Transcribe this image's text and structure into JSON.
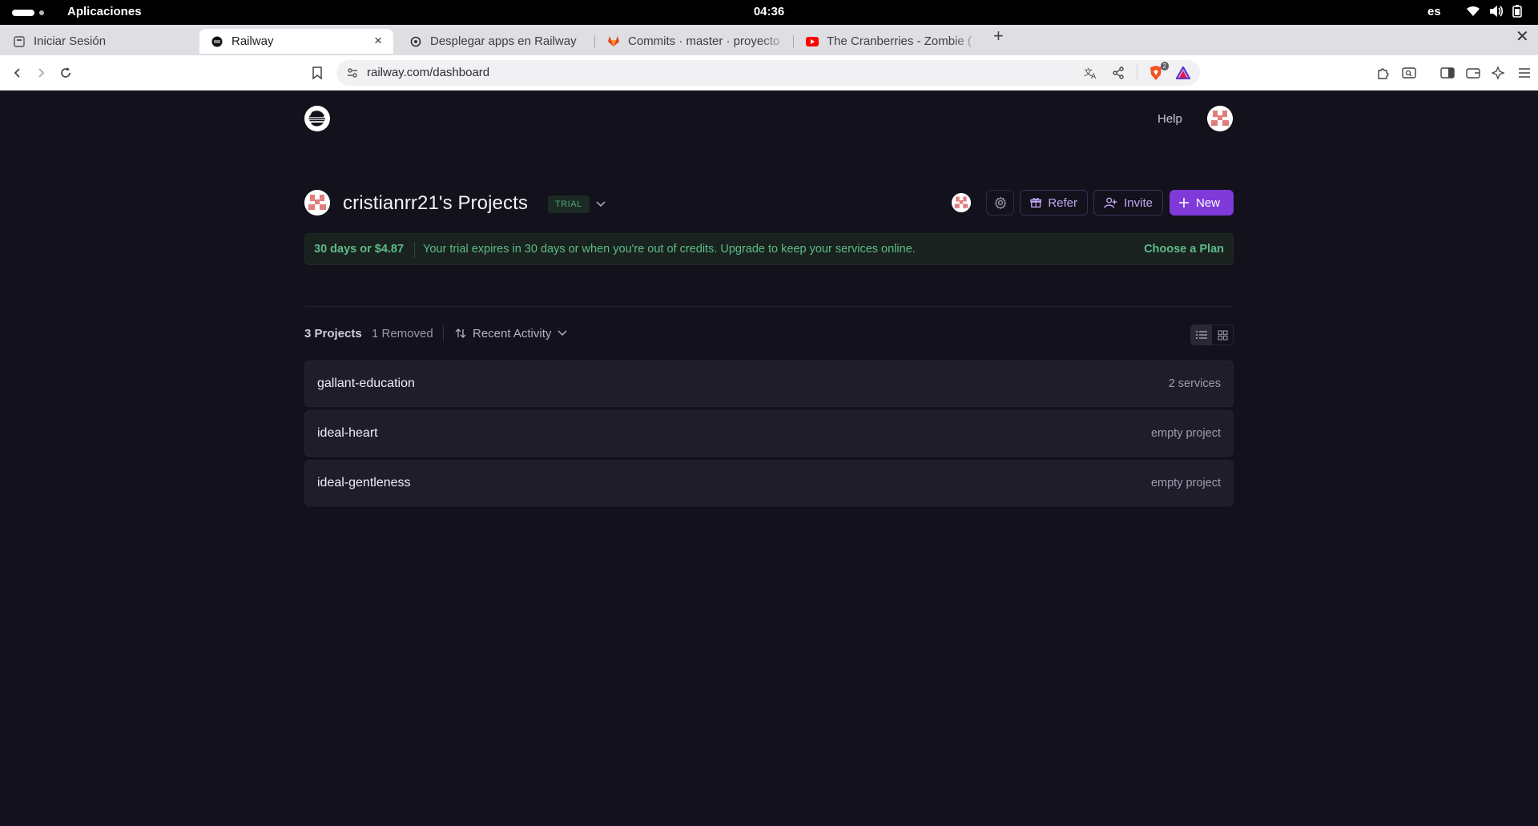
{
  "os": {
    "apps_label": "Aplicaciones",
    "clock": "04:36",
    "language": "es"
  },
  "tabs": [
    {
      "label": "Iniciar Sesión",
      "favicon": "page-icon",
      "active": false
    },
    {
      "label": "Railway",
      "favicon": "railway-icon",
      "active": true
    },
    {
      "label": "Desplegar apps en Railway",
      "favicon": "openai-icon",
      "active": false
    },
    {
      "label": "Commits · master · proyecto",
      "favicon": "gitlab-icon",
      "active": false
    },
    {
      "label": "The Cranberries - Zombie (",
      "favicon": "youtube-icon",
      "active": false
    }
  ],
  "browser": {
    "url": "railway.com/dashboard",
    "brave_badge": "2"
  },
  "header": {
    "help_label": "Help"
  },
  "workspace": {
    "title": "cristianrr21's Projects",
    "badge": "TRIAL",
    "refer_label": "Refer",
    "invite_label": "Invite",
    "new_label": "New"
  },
  "trial_banner": {
    "summary": "30 days or $4.87",
    "message": "Your trial expires in 30 days or when you're out of credits. Upgrade to keep your services online.",
    "cta": "Choose a Plan"
  },
  "filters": {
    "count_label": "3 Projects",
    "removed_label": "1 Removed",
    "sort_label": "Recent Activity"
  },
  "projects": [
    {
      "name": "gallant-education",
      "meta": "2 services"
    },
    {
      "name": "ideal-heart",
      "meta": "empty project"
    },
    {
      "name": "ideal-gentleness",
      "meta": "empty project"
    }
  ],
  "colors": {
    "page_bg": "#13111c",
    "accent": "#7f3ad9",
    "trial_green": "#5dbb88",
    "row_bg": "#1f1d2a"
  }
}
